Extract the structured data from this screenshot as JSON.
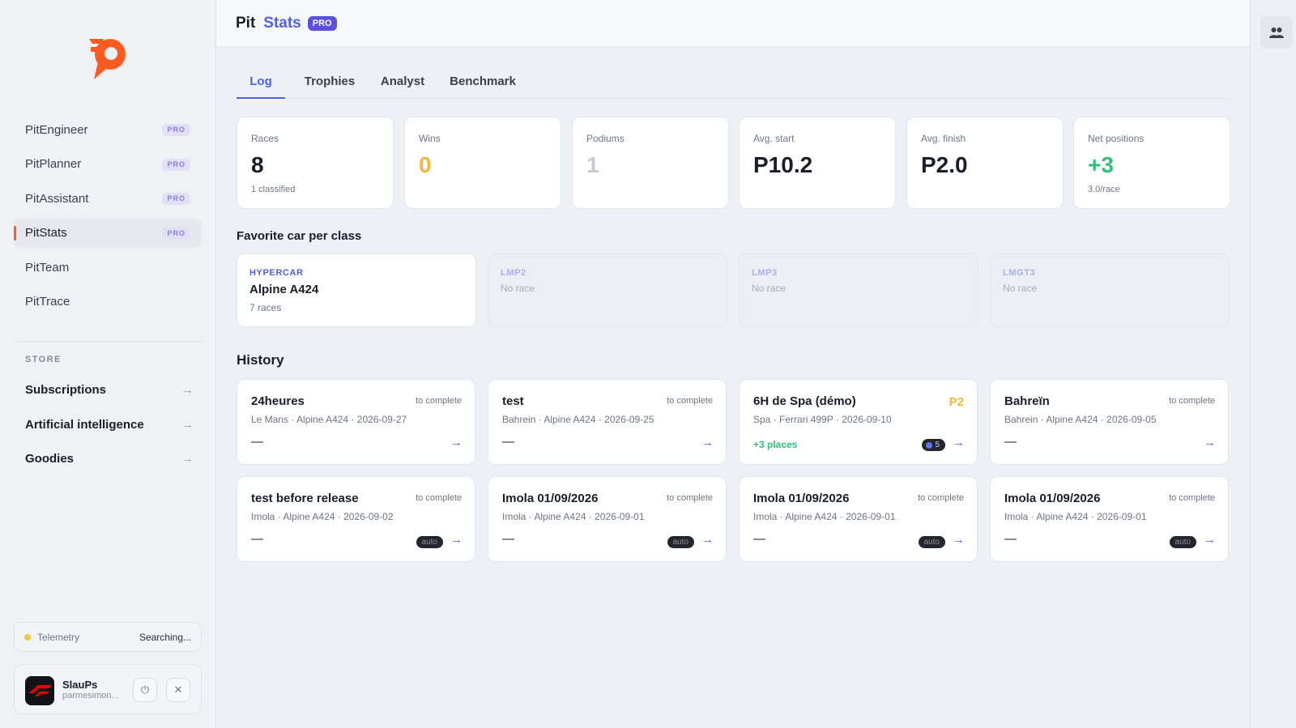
{
  "app": {
    "title_part1": "Pit",
    "title_part2": "Stats",
    "title_badge": "PRO"
  },
  "colors": {
    "accent": "#4f5fe6",
    "brand_orange": "#ff5a1f",
    "wins": "#f3b73a",
    "gain": "#2fbf7a"
  },
  "sidebar": {
    "items": [
      {
        "label": "PitEngineer",
        "badge": "PRO"
      },
      {
        "label": "PitPlanner",
        "badge": "PRO"
      },
      {
        "label": "PitAssistant",
        "badge": "PRO"
      },
      {
        "label": "PitStats",
        "badge": "PRO",
        "active": true
      },
      {
        "label": "PitTeam"
      },
      {
        "label": "PitTrace"
      }
    ],
    "store_label": "STORE",
    "store_items": [
      {
        "label": "Subscriptions",
        "arrow": "→"
      },
      {
        "label": "Artificial intelligence",
        "arrow": "→"
      },
      {
        "label": "Goodies",
        "arrow": "→"
      }
    ],
    "telemetry": {
      "label": "Telemetry",
      "status": "Searching..."
    },
    "user": {
      "name": "SlauPs",
      "email": "parmesimon...",
      "power_icon": "⏻",
      "close_icon": "✕"
    }
  },
  "tabs": [
    {
      "label": "Log",
      "active": true
    },
    {
      "label": "Trophies"
    },
    {
      "label": "Analyst"
    },
    {
      "label": "Benchmark"
    }
  ],
  "stats": [
    {
      "label": "Races",
      "value": "8",
      "sub": "1 classified",
      "color": "#1b1e28"
    },
    {
      "label": "Wins",
      "value": "0",
      "sub": "",
      "color": "#f3b73a"
    },
    {
      "label": "Podiums",
      "value": "1",
      "sub": "",
      "color": "#c6c9d3"
    },
    {
      "label": "Avg. start",
      "value": "P10.2",
      "sub": "",
      "color": "#1b1e28"
    },
    {
      "label": "Avg. finish",
      "value": "P2.0",
      "sub": "",
      "color": "#1b1e28"
    },
    {
      "label": "Net positions",
      "value": "+3",
      "sub": "3.0/race",
      "color": "#2fbf7a"
    }
  ],
  "favorites": {
    "title": "Favorite car per class",
    "classes": [
      {
        "class": "HYPERCAR",
        "car": "Alpine A424",
        "races": "7 races"
      },
      {
        "class": "LMP2",
        "none": "No race"
      },
      {
        "class": "LMP3",
        "none": "No race"
      },
      {
        "class": "LMGT3",
        "none": "No race"
      }
    ]
  },
  "history": {
    "title": "History",
    "races": [
      {
        "title": "24heures",
        "status": "to complete",
        "track": "Le Mans",
        "car": "Alpine A424",
        "date": "2026-09-27",
        "result": "—",
        "arrow": "→"
      },
      {
        "title": "test",
        "status": "to complete",
        "track": "Bahrein",
        "car": "Alpine A424",
        "date": "2026-09-25",
        "result": "—",
        "arrow": "→"
      },
      {
        "title": "6H de Spa (démo)",
        "status": "P2",
        "track": "Spa",
        "car": "Ferrari 499P",
        "date": "2026-09-10",
        "result": "+3 places",
        "badge": "5",
        "arrow": "→"
      },
      {
        "title": "Bahreïn",
        "status": "to complete",
        "track": "Bahrein",
        "car": "Alpine A424",
        "date": "2026-09-05",
        "result": "—",
        "arrow": "→"
      },
      {
        "title": "test before release",
        "status": "to complete",
        "track": "Imola",
        "car": "Alpine A424",
        "date": "2026-09-02",
        "result": "—",
        "badge": "auto",
        "arrow": "→"
      },
      {
        "title": "Imola 01/09/2026",
        "status": "to complete",
        "track": "Imola",
        "car": "Alpine A424",
        "date": "2026-09-01",
        "result": "—",
        "badge": "auto",
        "arrow": "→"
      },
      {
        "title": "Imola 01/09/2026",
        "status": "to complete",
        "track": "Imola",
        "car": "Alpine A424",
        "date": "2026-09-01",
        "result": "—",
        "badge": "auto",
        "arrow": "→"
      },
      {
        "title": "Imola 01/09/2026",
        "status": "to complete",
        "track": "Imola",
        "car": "Alpine A424",
        "date": "2026-09-01",
        "result": "—",
        "badge": "auto",
        "arrow": "→"
      }
    ]
  },
  "meta_separator": "·"
}
